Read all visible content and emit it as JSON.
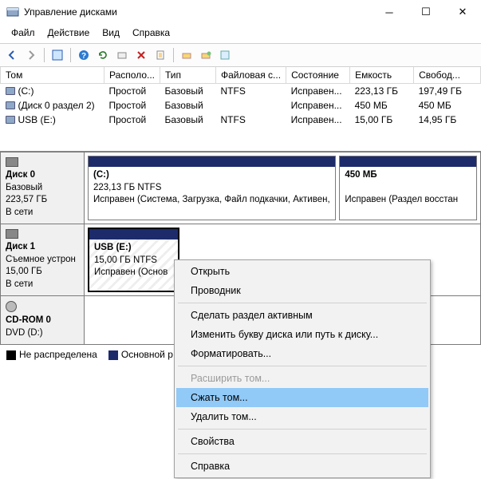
{
  "window": {
    "title": "Управление дисками"
  },
  "menu": {
    "file": "Файл",
    "action": "Действие",
    "view": "Вид",
    "help": "Справка"
  },
  "columns": {
    "vol": "Том",
    "layout": "Располо...",
    "type": "Тип",
    "fs": "Файловая с...",
    "status": "Состояние",
    "capacity": "Емкость",
    "free": "Свобод..."
  },
  "rows": [
    {
      "vol": "(C:)",
      "layout": "Простой",
      "type": "Базовый",
      "fs": "NTFS",
      "status": "Исправен...",
      "cap": "223,13 ГБ",
      "free": "197,49 ГБ"
    },
    {
      "vol": "(Диск 0 раздел 2)",
      "layout": "Простой",
      "type": "Базовый",
      "fs": "",
      "status": "Исправен...",
      "cap": "450 МБ",
      "free": "450 МБ"
    },
    {
      "vol": "USB (E:)",
      "layout": "Простой",
      "type": "Базовый",
      "fs": "NTFS",
      "status": "Исправен...",
      "cap": "15,00 ГБ",
      "free": "14,95 ГБ"
    }
  ],
  "disks": {
    "d0": {
      "name": "Диск 0",
      "type": "Базовый",
      "cap": "223,57 ГБ",
      "state": "В сети",
      "p0": {
        "title": "(C:)",
        "line": "223,13 ГБ NTFS",
        "status": "Исправен (Система, Загрузка, Файл подкачки, Активен,"
      },
      "p1": {
        "title": "450 МБ",
        "status": "Исправен (Раздел восстан"
      }
    },
    "d1": {
      "name": "Диск 1",
      "type": "Съемное устрон",
      "cap": "15,00 ГБ",
      "state": "В сети",
      "p0": {
        "title": "USB  (E:)",
        "line": "15,00 ГБ NTFS",
        "status": "Исправен (Основ"
      }
    },
    "cd": {
      "name": "CD-ROM 0",
      "sub": "DVD (D:)"
    }
  },
  "legend": {
    "unalloc": "Не распределена",
    "primary": "Основной р"
  },
  "ctx": {
    "open": "Открыть",
    "explorer": "Проводник",
    "active": "Сделать раздел активным",
    "letter": "Изменить букву диска или путь к диску...",
    "format": "Форматировать...",
    "extend": "Расширить том...",
    "shrink": "Сжать том...",
    "delete": "Удалить том...",
    "props": "Свойства",
    "help": "Справка"
  }
}
